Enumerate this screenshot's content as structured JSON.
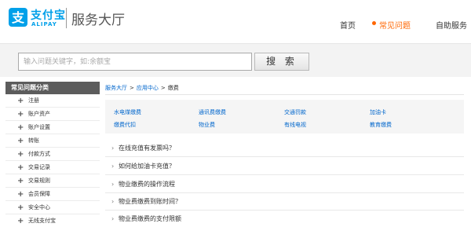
{
  "header": {
    "logo_icon": "alipay-logo-icon",
    "brand_cn": "支付宝",
    "brand_en": "ALIPAY",
    "section_title": "服务大厅",
    "nav": {
      "home": "首页",
      "faq": "常见问题",
      "self_service": "自助服务"
    },
    "accent_color": "#ff6600",
    "brand_color": "#00a0e9"
  },
  "search": {
    "placeholder": "输入问题关键字，如:余额宝",
    "button_label": "搜 索"
  },
  "sidebar": {
    "title": "常见问题分类",
    "items": [
      {
        "label": "注册"
      },
      {
        "label": "账户资产"
      },
      {
        "label": "账户设置"
      },
      {
        "label": "转账"
      },
      {
        "label": "付款方式"
      },
      {
        "label": "交易记录"
      },
      {
        "label": "交易规则"
      },
      {
        "label": "会员保障"
      },
      {
        "label": "安全中心"
      },
      {
        "label": "无线支付宝"
      }
    ]
  },
  "breadcrumb": {
    "items": [
      "服务大厅",
      "应用中心"
    ],
    "current": "缴费",
    "separator": ">"
  },
  "categories": {
    "row1": [
      "水电煤缴费",
      "通讯费缴费",
      "交通罚款",
      "加油卡"
    ],
    "row2": [
      "缴费代扣",
      "物业费",
      "有线电视",
      "教育缴费"
    ]
  },
  "questions": [
    {
      "text": "在线充值有发票吗？"
    },
    {
      "text": "如何给加油卡充值？"
    },
    {
      "text": "物业缴费的操作流程"
    },
    {
      "text": "物业费缴费到账时间？"
    },
    {
      "text": "物业费缴费的支付限额"
    }
  ]
}
